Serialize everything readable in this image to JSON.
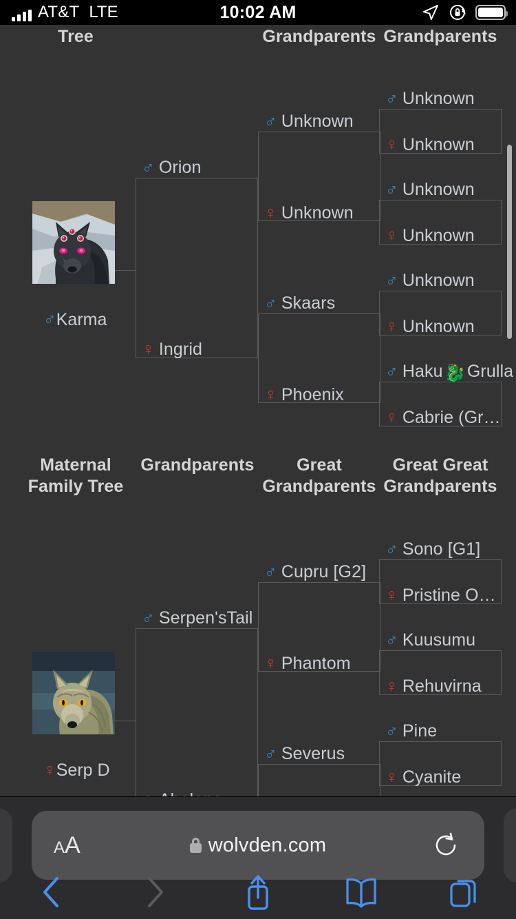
{
  "status_bar": {
    "carrier": "AT&T",
    "network": "LTE",
    "time": "10:02 AM",
    "icons": [
      "location-arrow-icon",
      "rotation-lock-icon",
      "battery-icon"
    ]
  },
  "colors": {
    "page_bg": "#333333",
    "male": "#3d84b8",
    "female": "#c0392b",
    "text": "#c9ced6",
    "header_text": "#d5d5d5",
    "border": "#5b5b5b",
    "safari_chrome": "#2c2c2e",
    "safari_tint": "#4a90f0"
  },
  "paternal_tree": {
    "headers": [
      {
        "label": "Tree"
      },
      {
        "label": "Grandparents"
      },
      {
        "label": "Grandparents"
      }
    ],
    "subject": {
      "name": "Karma",
      "sex": "male",
      "symbol": "♂"
    },
    "parents": [
      {
        "name": "Orion",
        "sex": "male",
        "symbol": "♂"
      },
      {
        "name": "Ingrid",
        "sex": "female",
        "symbol": "♀"
      }
    ],
    "grandparents": [
      {
        "name": "Unknown",
        "sex": "male",
        "symbol": "♂"
      },
      {
        "name": "Unknown",
        "sex": "female",
        "symbol": "♀"
      },
      {
        "name": "Skaars",
        "sex": "male",
        "symbol": "♂"
      },
      {
        "name": "Phoenix",
        "sex": "female",
        "symbol": "♀"
      }
    ],
    "great_grandparents": [
      {
        "name": "Unknown",
        "sex": "male",
        "symbol": "♂"
      },
      {
        "name": "Unknown",
        "sex": "female",
        "symbol": "♀"
      },
      {
        "name": "Unknown",
        "sex": "male",
        "symbol": "♂"
      },
      {
        "name": "Unknown",
        "sex": "female",
        "symbol": "♀"
      },
      {
        "name": "Unknown",
        "sex": "male",
        "symbol": "♂"
      },
      {
        "name": "Unknown",
        "sex": "female",
        "symbol": "♀"
      },
      {
        "name": "Haku",
        "name_suffix": "Grulla",
        "emoji": "dragon-emoji",
        "sex": "male",
        "symbol": "♂"
      },
      {
        "name": "Cabrie (Grulla…",
        "sex": "female",
        "symbol": "♀"
      }
    ]
  },
  "maternal_tree": {
    "headers": [
      {
        "label": "Maternal Family Tree"
      },
      {
        "label": "Grandparents"
      },
      {
        "label": "Great Grandparents"
      },
      {
        "label": "Great Great Grandparents"
      }
    ],
    "subject": {
      "name": "Serp D",
      "sex": "female",
      "symbol": "♀"
    },
    "parents": [
      {
        "name": "Serpen'sTail",
        "sex": "male",
        "symbol": "♂"
      },
      {
        "name": "Abalone",
        "sex": "female",
        "symbol": "♀"
      }
    ],
    "grandparents": [
      {
        "name": "Cupru [G2]",
        "sex": "male",
        "symbol": "♂"
      },
      {
        "name": "Phantom",
        "sex": "female",
        "symbol": "♀"
      },
      {
        "name": "Severus",
        "sex": "male",
        "symbol": "♂"
      }
    ],
    "great_grandparents": [
      {
        "name": "Sono [G1]",
        "sex": "male",
        "symbol": "♂"
      },
      {
        "name": "Pristine Oak …",
        "sex": "female",
        "symbol": "♀"
      },
      {
        "name": "Kuusumu",
        "sex": "male",
        "symbol": "♂"
      },
      {
        "name": "Rehuvirna",
        "sex": "female",
        "symbol": "♀"
      },
      {
        "name": "Pine",
        "sex": "male",
        "symbol": "♂"
      },
      {
        "name": "Cyanite",
        "sex": "female",
        "symbol": "♀"
      }
    ]
  },
  "browser": {
    "text_size_label": "AA",
    "url": "wolvden.com",
    "secure": true,
    "reload_icon": "reload-icon",
    "toolbar": [
      {
        "name": "back-button",
        "icon": "chevron-left-icon",
        "enabled": true
      },
      {
        "name": "forward-button",
        "icon": "chevron-right-icon",
        "enabled": false
      },
      {
        "name": "share-button",
        "icon": "share-icon",
        "enabled": true
      },
      {
        "name": "bookmarks-button",
        "icon": "book-icon",
        "enabled": true
      },
      {
        "name": "tabs-button",
        "icon": "tabs-icon",
        "enabled": true
      }
    ]
  }
}
